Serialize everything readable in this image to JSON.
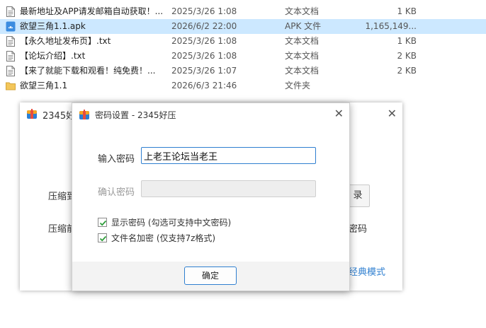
{
  "files": [
    {
      "name": "最新地址及APP请发邮箱自动获取！...",
      "date": "2025/3/26 1:08",
      "type": "文本文档",
      "size": "1 KB",
      "icon": "text-file-icon",
      "selected": false
    },
    {
      "name": "欲望三角1.1.apk",
      "date": "2026/6/2 22:00",
      "type": "APK 文件",
      "size": "1,165,149...",
      "icon": "apk-file-icon",
      "selected": true
    },
    {
      "name": "【永久地址发布页】.txt",
      "date": "2025/3/26 1:08",
      "type": "文本文档",
      "size": "1 KB",
      "icon": "text-file-icon",
      "selected": false
    },
    {
      "name": "【论坛介绍】.txt",
      "date": "2025/3/26 1:08",
      "type": "文本文档",
      "size": "2 KB",
      "icon": "text-file-icon",
      "selected": false
    },
    {
      "name": "【来了就能下载和观看！纯免费！...",
      "date": "2025/3/26 1:07",
      "type": "文本文档",
      "size": "2 KB",
      "icon": "text-file-icon",
      "selected": false
    },
    {
      "name": "欲望三角1.1",
      "date": "2026/6/3 21:46",
      "type": "文件夹",
      "size": "",
      "icon": "folder-icon",
      "selected": false
    }
  ],
  "bg_window": {
    "title": "2345好",
    "label_a": "压缩到",
    "label_b": "压缩前",
    "browse_label": "录",
    "right_text": "密码",
    "classic_link": "经典模式"
  },
  "dialog": {
    "title": "密码设置 - 2345好压",
    "password_label": "输入密码",
    "password_value": "上老王论坛当老王",
    "confirm_label": "确认密码",
    "show_password_label": "显示密码 (勾选可支持中文密码)",
    "encrypt_names_label": "文件名加密 (仅支持7z格式)",
    "show_password_checked": true,
    "encrypt_names_checked": true,
    "ok_label": "确定"
  },
  "colors": {
    "selection": "#cce8ff",
    "accent": "#2f7fd0",
    "check": "#2e9d3a"
  }
}
